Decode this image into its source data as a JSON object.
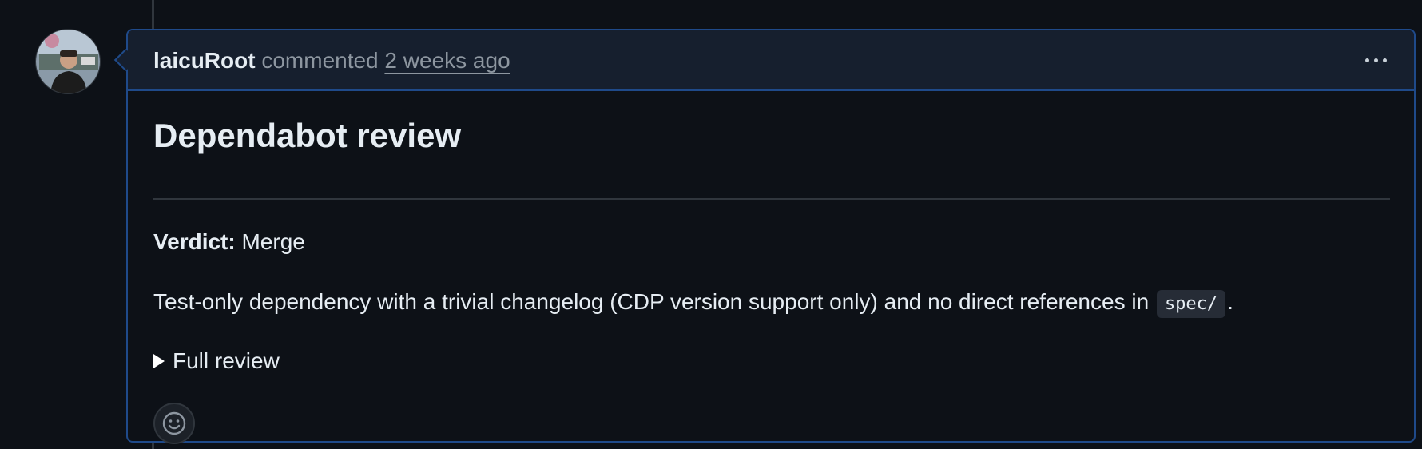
{
  "comment": {
    "author": "laicuRoot",
    "action": "commented",
    "timestamp": "2 weeks ago"
  },
  "body": {
    "title": "Dependabot review",
    "verdict_label": "Verdict:",
    "verdict_value": "Merge",
    "summary_text": "Test-only dependency with a trivial changelog (CDP version support only) and no direct references in",
    "summary_code": "spec/",
    "summary_end": ".",
    "details_label": "Full review"
  },
  "icons": {
    "menu": "kebab-horizontal-icon",
    "emoji": "smiley-icon",
    "details": "triangle-right-icon"
  },
  "colors": {
    "background": "#0d1117",
    "header_bg": "#161f2e",
    "border_accent": "#1f4a8a",
    "muted_text": "#8d96a0",
    "text": "#e6edf3"
  }
}
